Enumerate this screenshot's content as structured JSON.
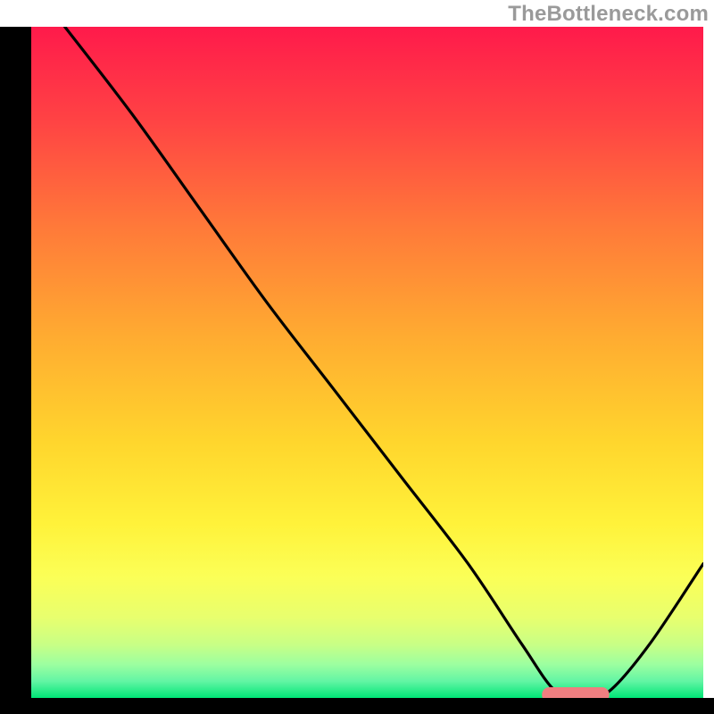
{
  "watermark": "TheBottleneck.com",
  "chart_data": {
    "type": "line",
    "title": "",
    "xlabel": "",
    "ylabel": "",
    "xlim": [
      0,
      100
    ],
    "ylim": [
      0,
      100
    ],
    "axis_visible": {
      "x": true,
      "y": true
    },
    "grid": false,
    "background_gradient_colors_top_to_bottom": [
      "#ff1a4b",
      "#ff5540",
      "#ff8a36",
      "#ffc22f",
      "#ffe92e",
      "#fbff4a",
      "#ccff7a",
      "#86ffa5",
      "#00e676"
    ],
    "curve_description": "V-shaped bottleneck curve: steep fall from top-left, bending shallower near x≈25, long near-linear descent to a flat minimum around x≈78–85, then rising toward the right edge",
    "series": [
      {
        "name": "bottleneck-curve",
        "color": "#000000",
        "x": [
          5,
          15,
          25,
          35,
          45,
          55,
          65,
          73,
          78,
          82,
          86,
          92,
          100
        ],
        "y": [
          100,
          87,
          73,
          59,
          46,
          33,
          20,
          8,
          1,
          0,
          1,
          8,
          20
        ]
      }
    ],
    "marker": {
      "name": "optimal-range-marker",
      "shape": "rounded-bar",
      "color": "#ef7e80",
      "x_range": [
        76,
        86
      ],
      "y": 0
    }
  }
}
